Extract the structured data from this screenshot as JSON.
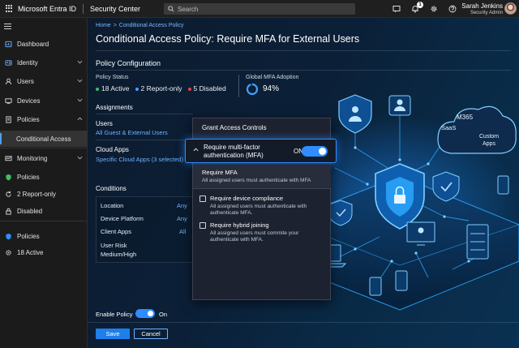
{
  "topbar": {
    "brand": "Microsoft Entra ID",
    "section": "Security Center",
    "search_placeholder": "Search",
    "notification_count": "1",
    "user_name": "Sarah Jenkins",
    "user_role": "Security Admin"
  },
  "sidebar": {
    "items": [
      {
        "label": "Dashboard",
        "icon": "dashboard-icon"
      },
      {
        "label": "Identity",
        "icon": "identity-icon"
      },
      {
        "label": "Users",
        "icon": "user-icon"
      },
      {
        "label": "Devices",
        "icon": "device-icon"
      },
      {
        "label": "Policies",
        "icon": "policy-icon"
      },
      {
        "label": "Conditional Access",
        "icon": ""
      },
      {
        "label": "Monitoring",
        "icon": "monitoring-icon"
      },
      {
        "label": "Policies",
        "icon": "shield-icon"
      },
      {
        "label": "2 Report-only",
        "icon": "refresh-icon"
      },
      {
        "label": "Disabled",
        "icon": "lock-icon"
      },
      {
        "label": "Policies",
        "icon": "shield-icon"
      },
      {
        "label": "18 Active",
        "icon": "gear-icon"
      }
    ]
  },
  "breadcrumb": {
    "home": "Home",
    "current": "Conditional Access Policy"
  },
  "page_title": "Conditional Access Policy: Require MFA for External Users",
  "policy_config": {
    "title": "Policy Configuration",
    "status_label": "Policy Status",
    "active": "18 Active",
    "report_only": "2 Report-only",
    "disabled": "5 Disabled",
    "mfa_label": "Global MFA Adoption",
    "mfa_value": "94%",
    "mfa_fraction": 0.94
  },
  "assignments": {
    "title": "Assignments",
    "users_label": "Users",
    "users_value": "All Guest & External Users",
    "apps_label": "Cloud Apps",
    "apps_value": "Specific Cloud Apps (3 selected)"
  },
  "conditions": {
    "title": "Conditions",
    "rows": [
      {
        "label": "Location",
        "value": "Any"
      },
      {
        "label": "Device Platform",
        "value": "Any"
      },
      {
        "label": "Client Apps",
        "value": "All"
      },
      {
        "label": "User Risk\nMedium/High",
        "value": ""
      }
    ]
  },
  "grant_panel": {
    "title": "Grant Access Controls",
    "mfa_title": "Require multi-factor authentication (MFA)",
    "mfa_state": "ON",
    "require_mfa_title": "Require MFA",
    "require_mfa_desc": "All assigned users must authenticate with MFA",
    "device_title": "Require device compliance",
    "device_desc": "All assigned users must authenticate with authenticate MFA.",
    "hybrid_title": "Require hybrid joining",
    "hybrid_desc": "All assigned users must commite your authenticate with MFA."
  },
  "illustration": {
    "m365": "M365",
    "saas": "SaaS",
    "custom": "Custom",
    "apps": "Apps"
  },
  "footer": {
    "enable_label": "Enable Policy",
    "enable_state": "On",
    "save": "Save",
    "cancel": "Cancel"
  },
  "colors": {
    "accent": "#2f8dff",
    "active": "#3fbf5f",
    "report": "#4aa0ff",
    "disabled": "#e0473f"
  }
}
